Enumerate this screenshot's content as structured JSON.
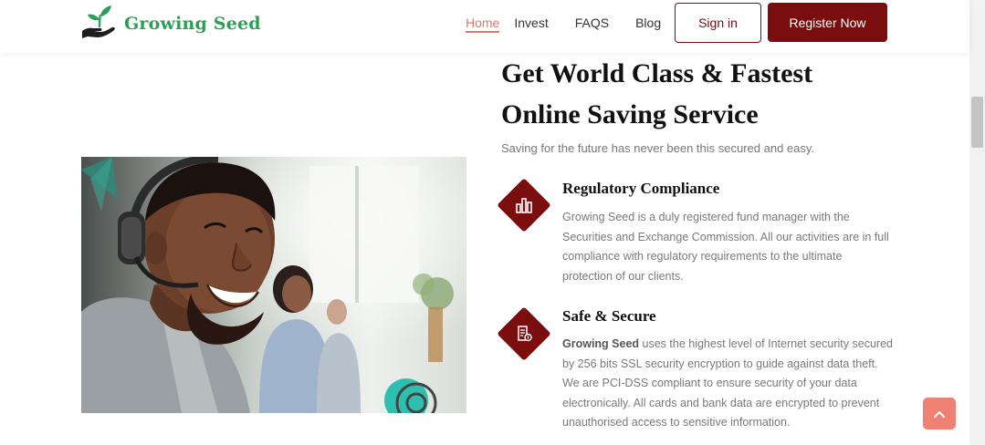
{
  "brand": {
    "name": "Growing Seed"
  },
  "nav": {
    "items": [
      {
        "label": "Home",
        "active": true
      },
      {
        "label": "Invest"
      },
      {
        "label": "FAQS"
      },
      {
        "label": "Blog"
      }
    ],
    "signin_label": "Sign in",
    "register_label": "Register Now"
  },
  "hero": {
    "title_line1": "Get World Class & Fastest",
    "title_line2": "Online Saving Service",
    "subtitle": "Saving for the future has never been this secured and easy."
  },
  "features": [
    {
      "title": "Regulatory Compliance",
      "icon": "bar-chart-icon",
      "body": "Growing Seed is a duly registered fund manager with the Securities and Exchange Commission. All our activities are in full compliance with regulatory requirements to the ultimate protection of our clients."
    },
    {
      "title": "Safe & Secure",
      "icon": "secure-document-icon",
      "body_bold": "Growing Seed",
      "body": " uses the highest level of Internet security secured by 256 bits SSL security encryption to guide against data theft. We are PCI-DSS compliant to ensure security of your data electronically. All cards and bank data are encrypted to prevent unauthorised access to sensitive information."
    }
  ],
  "colors": {
    "brand_green": "#2e9e57",
    "primary_maroon": "#7a0d0d",
    "accent_coral": "#ef8074"
  },
  "back_to_top": {
    "icon": "chevron-up-icon"
  }
}
